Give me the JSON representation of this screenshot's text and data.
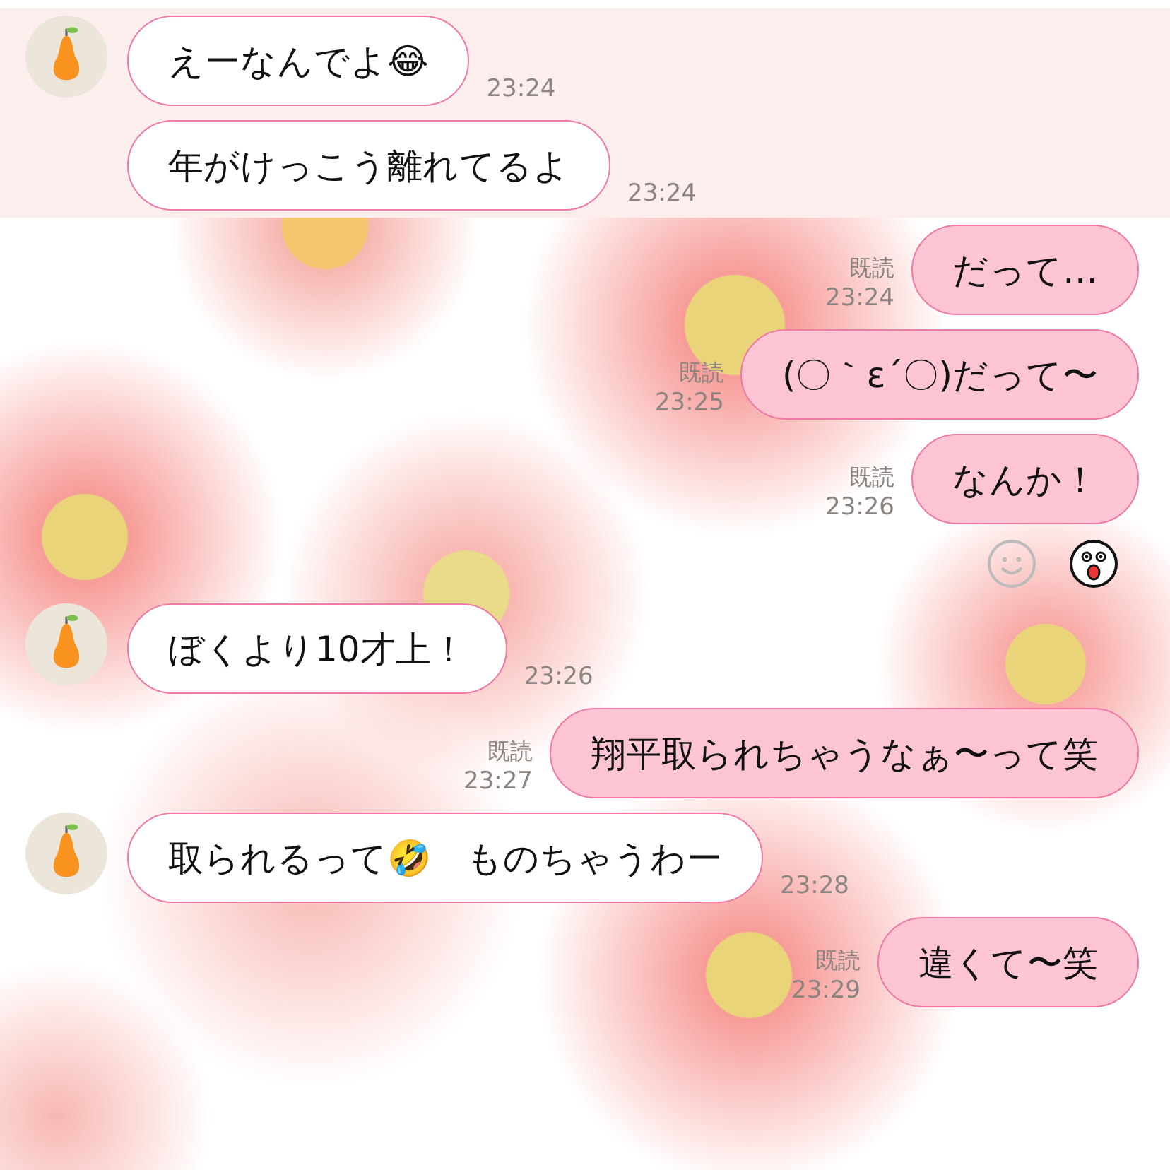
{
  "messages": [
    {
      "kind": "received",
      "avatar": true,
      "highlighted": true,
      "text": "えーなんでよ😂",
      "time": "23:24"
    },
    {
      "kind": "received",
      "avatar": false,
      "highlighted": true,
      "text": "年がけっこう離れてるよ",
      "time": "23:24"
    },
    {
      "kind": "sent",
      "read": "既読",
      "highlighted": false,
      "text": "だって…",
      "time": "23:24"
    },
    {
      "kind": "sent",
      "read": "既読",
      "highlighted": false,
      "text": "(〇｀ε´〇)だって〜",
      "time": "23:25"
    },
    {
      "kind": "sent",
      "read": "既読",
      "highlighted": false,
      "text": "なんか！",
      "time": "23:26"
    },
    {
      "kind": "reactions",
      "highlighted": false
    },
    {
      "kind": "received",
      "avatar": true,
      "highlighted": false,
      "text": "ぼくより10才上！",
      "time": "23:26"
    },
    {
      "kind": "sent",
      "read": "既読",
      "highlighted": false,
      "text": "翔平取られちゃうなぁ〜って笑",
      "time": "23:27"
    },
    {
      "kind": "received",
      "avatar": true,
      "highlighted": false,
      "text": "取られるって🤣　ものちゃうわー",
      "time": "23:28"
    },
    {
      "kind": "sent",
      "read": "既読",
      "highlighted": false,
      "text": "違くて〜笑",
      "time": "23:29"
    }
  ]
}
